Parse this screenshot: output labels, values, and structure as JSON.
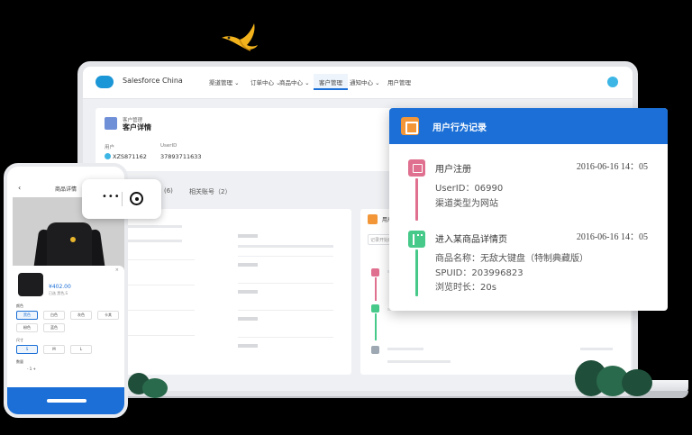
{
  "nav": {
    "app_name": "Salesforce China",
    "items": [
      "渠道管理",
      "订单中心",
      "商品中心",
      "客户管理",
      "通知中心",
      "用户管理"
    ],
    "active_index": 3
  },
  "header": {
    "sub": "客户管理",
    "title": "客户详情",
    "fields": [
      {
        "label": "用户",
        "value": "XZS871162"
      },
      {
        "label": "UserID",
        "value": "37893711633"
      }
    ]
  },
  "tabs": {
    "count_label": "(6)",
    "related": "相关账号（2）"
  },
  "mini_card": {
    "title": "用户",
    "search_placeholder": "记录开始时间"
  },
  "popup": {
    "title": "用户行为记录",
    "events": [
      {
        "title": "用户注册",
        "time": "2016-06-16 14：05",
        "lines": [
          "UserID：06990",
          "渠道类型为网站"
        ],
        "color": "#e0708f"
      },
      {
        "title": "进入某商品详情页",
        "time": "2016-06-16 14：05",
        "lines": [
          "商品名称：无敌大键盘（特制典藏版）",
          "SPUID：203996823",
          "浏览时长：20s"
        ],
        "color": "#47c98a"
      }
    ]
  },
  "phone": {
    "back_icon": "‹",
    "title": "商品详情",
    "price": "¥402.00",
    "stock": "已选 黑色,S",
    "color_label": "颜色",
    "colors": [
      "黑色",
      "白色",
      "灰色",
      "卡其",
      "粉色",
      "蓝色"
    ],
    "size_label": "尺寸",
    "sizes": [
      "S",
      "M",
      "L"
    ],
    "qty_label": "数量",
    "qty": "- 1 +"
  },
  "capsule": {
    "more_glyph": "•••"
  },
  "colors": {
    "primary": "#1b6fd6",
    "accent": "#f29638",
    "register": "#e0708f",
    "view": "#47c98a"
  }
}
